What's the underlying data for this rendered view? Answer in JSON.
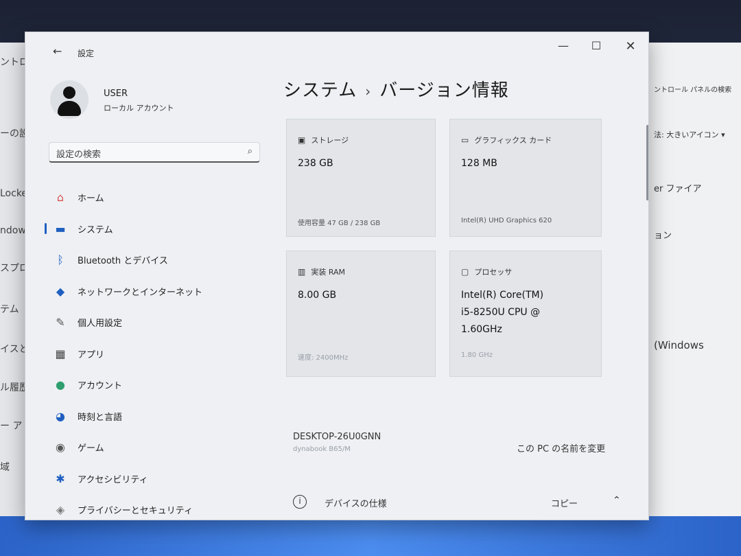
{
  "background": {
    "left_texts": [
      "ントロール",
      "ーの設定",
      "Locker",
      "ndows",
      "スプロー",
      "テム",
      "イスとフ",
      "ル履歴",
      "ー ア",
      "域"
    ],
    "right_texts": [
      "ントロール パネルの検索",
      "法: 大きいアイコン ▾",
      "er ファイア",
      "ョン",
      "(Windows"
    ]
  },
  "window": {
    "app_title": "設定",
    "back_icon": "←",
    "minimize": "—",
    "maximize": "☐",
    "close": "✕"
  },
  "profile": {
    "name": "USER",
    "account_type": "ローカル アカウント"
  },
  "search": {
    "placeholder": "設定の検索",
    "icon": "⌕"
  },
  "nav": [
    {
      "label": "ホーム",
      "icon": "home-icon",
      "glyph": "⌂",
      "color": "#d9534f"
    },
    {
      "label": "システム",
      "icon": "system-icon",
      "glyph": "▬",
      "color": "#1f5fc0",
      "active": true
    },
    {
      "label": "Bluetooth とデバイス",
      "icon": "bluetooth-icon",
      "glyph": "ᛒ",
      "color": "#1f5fc0"
    },
    {
      "label": "ネットワークとインターネット",
      "icon": "network-icon",
      "glyph": "◆",
      "color": "#1f5fc0"
    },
    {
      "label": "個人用設定",
      "icon": "brush-icon",
      "glyph": "✎",
      "color": "#555"
    },
    {
      "label": "アプリ",
      "icon": "apps-icon",
      "glyph": "▦",
      "color": "#444"
    },
    {
      "label": "アカウント",
      "icon": "account-icon",
      "glyph": "●",
      "color": "#2e9e6f"
    },
    {
      "label": "時刻と言語",
      "icon": "globe-icon",
      "glyph": "◕",
      "color": "#1f5fc0"
    },
    {
      "label": "ゲーム",
      "icon": "gamepad-icon",
      "glyph": "◉",
      "color": "#555"
    },
    {
      "label": "アクセシビリティ",
      "icon": "accessibility-icon",
      "glyph": "✱",
      "color": "#1f5fc0"
    },
    {
      "label": "プライバシーとセキュリティ",
      "icon": "shield-icon",
      "glyph": "◈",
      "color": "#777"
    }
  ],
  "page": {
    "section": "システム",
    "separator": "›",
    "title": "バージョン情報"
  },
  "cards": {
    "storage": {
      "label": "ストレージ",
      "value": "238 GB",
      "sub": "使用容量 47 GB / 238 GB"
    },
    "graphics": {
      "label": "グラフィックス カード",
      "value": "128 MB",
      "sub": "Intel(R) UHD Graphics 620"
    },
    "ram": {
      "label": "実装 RAM",
      "value": "8.00 GB",
      "sub": "速度: 2400MHz"
    },
    "processor": {
      "label": "プロセッサ",
      "value_lines": [
        "Intel(R) Core(TM)",
        "i5-8250U CPU @",
        "1.60GHz"
      ],
      "sub": "1.80 GHz"
    }
  },
  "device": {
    "name": "DESKTOP-26U0GNN",
    "model": "dynabook B65/M",
    "rename_link": "この PC の名前を変更"
  },
  "bottom": {
    "info_glyph": "i",
    "specs_label": "デバイスの仕様",
    "copy_label": "コピー",
    "chevron": "⌃"
  }
}
